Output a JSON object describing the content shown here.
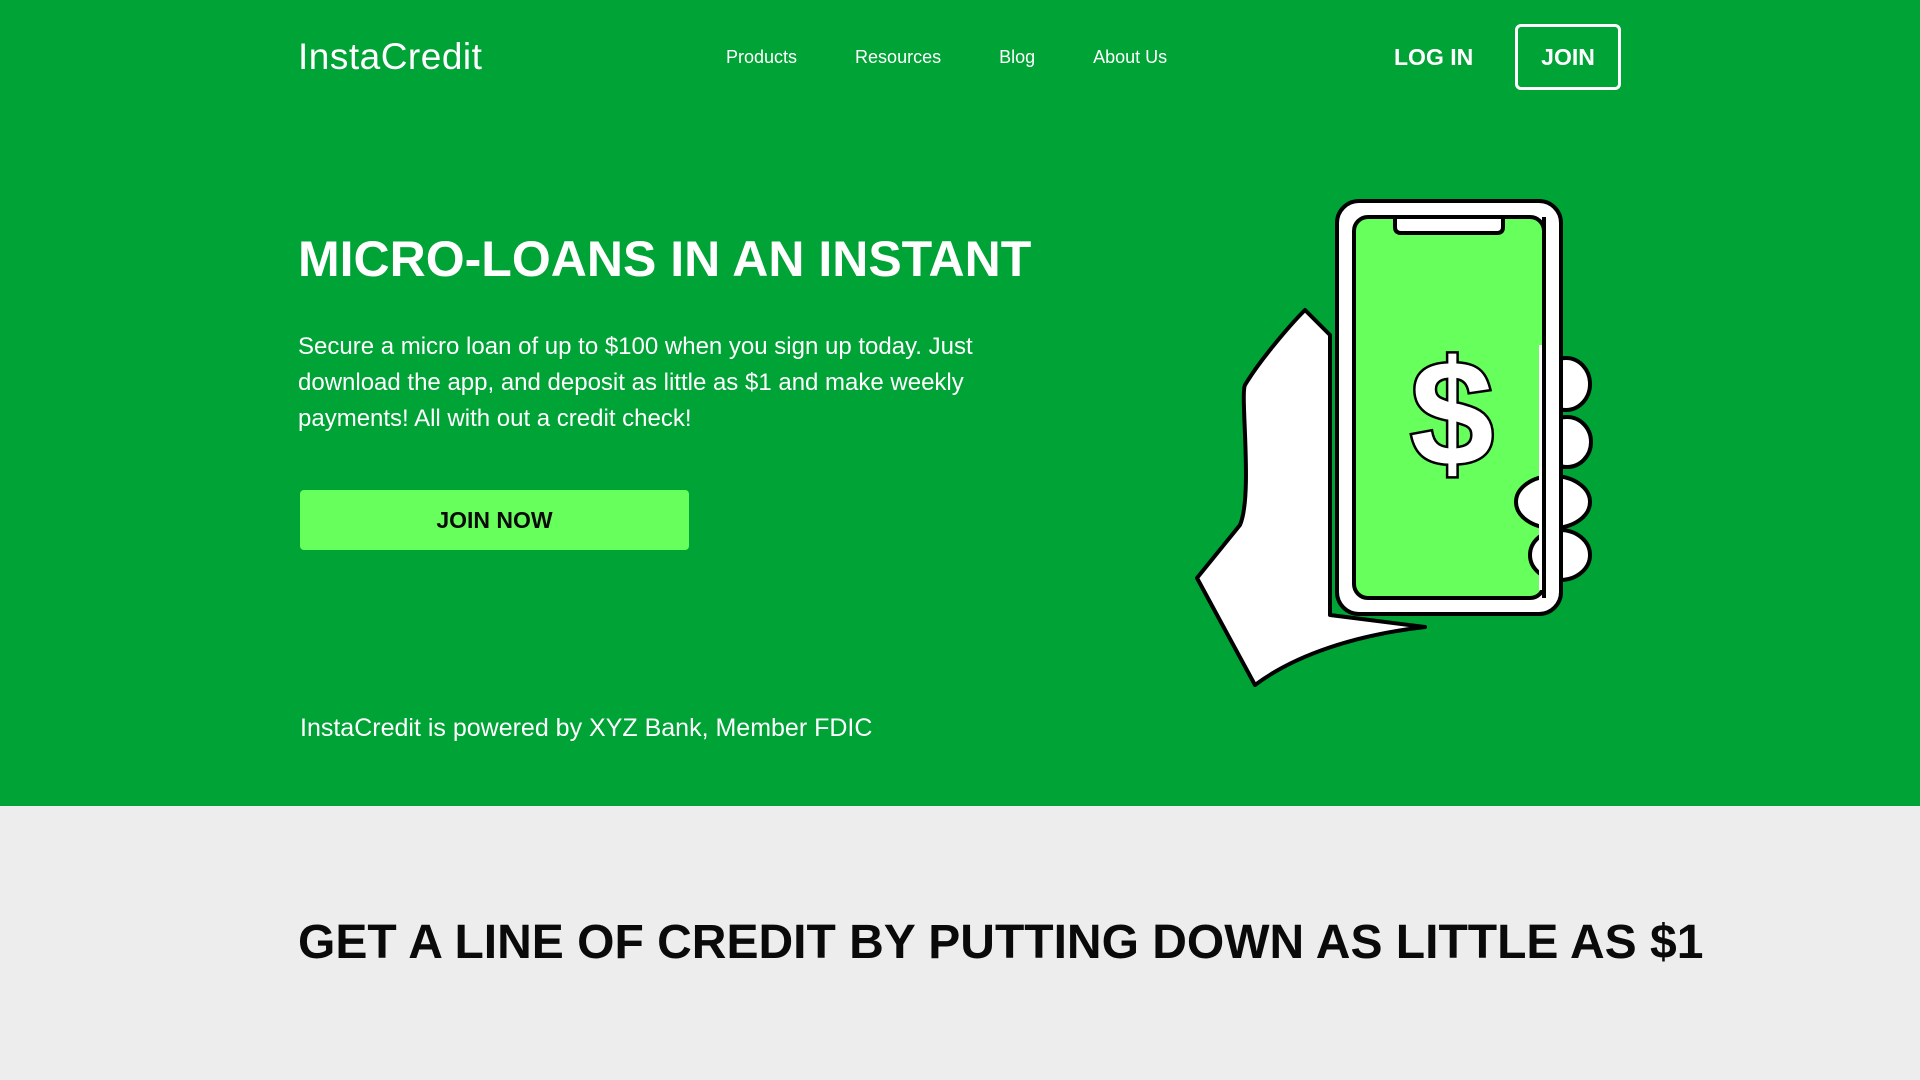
{
  "brand": {
    "name": "InstaCredit",
    "primary_color": "#00a335",
    "accent_color": "#66ff5c",
    "section_background": "#ededed"
  },
  "nav": {
    "links": [
      {
        "label": "Products"
      },
      {
        "label": "Resources"
      },
      {
        "label": "Blog"
      },
      {
        "label": "About Us"
      }
    ],
    "login_label": "LOG IN",
    "join_label": "JOIN"
  },
  "hero": {
    "title": "MICRO-LOANS IN AN INSTANT",
    "body": "Secure a micro loan of up to $100 when you sign up today. Just download the app, and deposit as little as $1 and make weekly payments! All with out a credit check!",
    "cta_label": "JOIN NOW",
    "disclaimer": "InstaCredit is powered by XYZ Bank, Member FDIC",
    "illustration": {
      "icon": "hand-holding-phone-icon",
      "screen_symbol": "$"
    }
  },
  "section": {
    "title": "GET A LINE OF CREDIT BY PUTTING DOWN AS LITTLE AS $1"
  }
}
